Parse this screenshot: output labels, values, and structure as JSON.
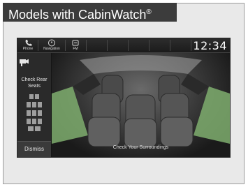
{
  "header": {
    "title": "Models with CabinWatch",
    "trademark": "®"
  },
  "topbar": {
    "phone_label": "Phone",
    "navigation_label": "Navigation",
    "fm_label": "FM",
    "clock": "12:34"
  },
  "sidebar": {
    "check_label_line1": "Check Rear",
    "check_label_line2": "Seats",
    "dismiss_label": "Dismiss"
  },
  "camera": {
    "caption": "Check Your Surroundings"
  },
  "colors": {
    "header_bg": "#3c3c3c",
    "screen_bg": "#151515",
    "guide_green": "#7fae6e"
  }
}
